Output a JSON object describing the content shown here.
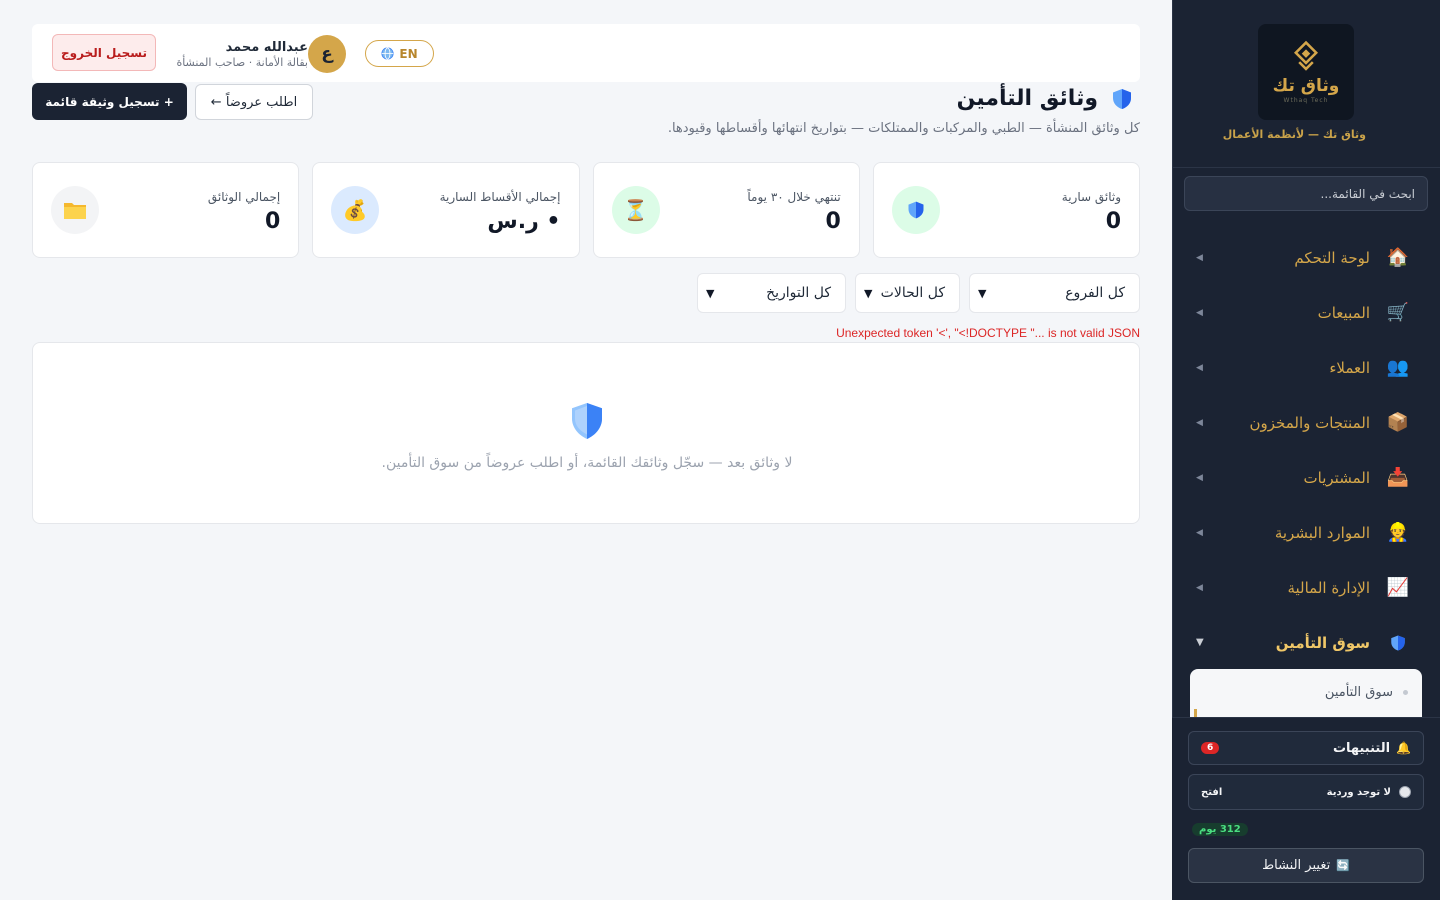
{
  "brand": {
    "name": "وثاق تك",
    "subtitle": "Wthaq Tech",
    "tagline": "وثاق تك — لأنظمة الأعمال",
    "gold": "#d4a64a"
  },
  "sidebar": {
    "search_placeholder": "ابحث في القائمة...",
    "items": [
      {
        "label": "لوحة التحكم",
        "icon": "🏠",
        "icon_name": "home-icon"
      },
      {
        "label": "المبيعات",
        "icon": "🛒",
        "icon_name": "cart-icon"
      },
      {
        "label": "العملاء",
        "icon": "👥",
        "icon_name": "users-icon"
      },
      {
        "label": "المنتجات والمخزون",
        "icon": "📦",
        "icon_name": "package-icon"
      },
      {
        "label": "المشتريات",
        "icon": "📥",
        "icon_name": "inbox-icon"
      },
      {
        "label": "الموارد البشرية",
        "icon": "👷",
        "icon_name": "worker-icon"
      },
      {
        "label": "الإدارة المالية",
        "icon": "📈",
        "icon_name": "chart-icon"
      },
      {
        "label": "سوق التأمين",
        "icon": "shield",
        "icon_name": "shield-icon",
        "active": true
      }
    ],
    "submenu": [
      {
        "label": "سوق التأمين"
      }
    ],
    "notifications": {
      "label": "التنبيهات",
      "count": "6",
      "icon": "🔔"
    },
    "shift": {
      "label": "لا توجد وردية",
      "action": "افتح"
    },
    "days_badge": "312 يوم",
    "change_activity": {
      "label": "تغيير النشاط",
      "icon": "🔄"
    }
  },
  "topbar": {
    "user_name": "عبدالله محمد",
    "user_role": "بقالة الأمانة · صاحب المنشأة",
    "avatar_letter": "ع",
    "lang": "EN",
    "logout": "تسجيل الخروج"
  },
  "page": {
    "title": "وثائق التأمين",
    "description": "كل وثائق المنشأة — الطبي والمركبات والممتلكات — بتواريخ انتهائها وأقساطها وقيودها.",
    "primary_action": "+ تسجيل وثيقة قائمة",
    "secondary_action": "اطلب عروضاً ←"
  },
  "stats": [
    {
      "label": "وثائق سارية",
      "value": "0",
      "icon": "🛡️",
      "icon_name": "shield-icon",
      "bg": "#dcfce7"
    },
    {
      "label": "تنتهي خلال ٣٠ يوماً",
      "value": "0",
      "icon": "⏳",
      "icon_name": "hourglass-icon",
      "bg": "#dcfce7"
    },
    {
      "label": "إجمالي الأقساط السارية",
      "value": "• ر.س",
      "icon": "💰",
      "icon_name": "money-bag-icon",
      "bg": "#dbeafe"
    },
    {
      "label": "إجمالي الوثائق",
      "value": "0",
      "icon": "📁",
      "icon_name": "folder-icon",
      "bg": "#f3f4f6"
    }
  ],
  "filters": {
    "branches": "كل الفروع",
    "statuses": "كل الحالات",
    "dates": "كل التواريخ"
  },
  "error": "Unexpected token '<', \"<!DOCTYPE \"... is not valid JSON",
  "empty_state": "لا وثائق بعد — سجّل وثائقك القائمة، أو اطلب عروضاً من سوق التأمين."
}
